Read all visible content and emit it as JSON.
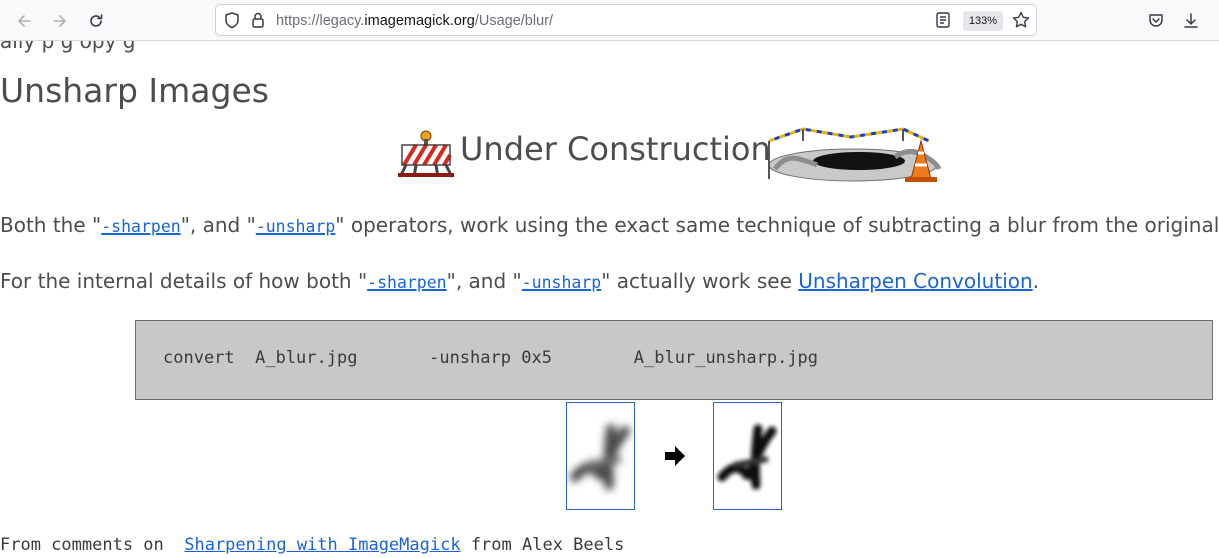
{
  "browser": {
    "url_prefix": "https://legacy.",
    "url_host": "imagemagick.org",
    "url_path": "/Usage/blur/",
    "zoom": "133%",
    "icons": [
      "back-icon",
      "forward-icon",
      "reload-icon",
      "shield-icon",
      "lock-icon",
      "reader-view-icon",
      "bookmark-star-icon",
      "pocket-icon",
      "download-icon"
    ]
  },
  "page": {
    "cut_off_text": "ally p                                                   g              opy g",
    "heading": "Unsharp Images",
    "construction_title": "Under Construction",
    "para1": {
      "t1": "Both the \"",
      "link1": "-sharpen",
      "t2": "\", and \"",
      "link2": "-unsharp",
      "t3": "\" operators, work using the exact same technique of subtracting a blur from the original image."
    },
    "para2": {
      "t1": "For the internal details of how both \"",
      "link1": "-sharpen",
      "t2": "\", and \"",
      "link2": "-unsharp",
      "t3": "\" actually work see ",
      "link3": "Unsharpen Convolution",
      "t4": "."
    },
    "command": "convert  A_blur.jpg       -unsharp 0x5        A_blur_unsharp.jpg",
    "footer": {
      "t1": "From comments on  ",
      "link": "Sharpening with ImageMagick",
      "t2": " from Alex Beels"
    }
  },
  "colors": {
    "link": "#1a64d9",
    "text": "#4d4d4d",
    "codebox_bg": "#c8c8c8",
    "image_border": "#2d66c8"
  }
}
